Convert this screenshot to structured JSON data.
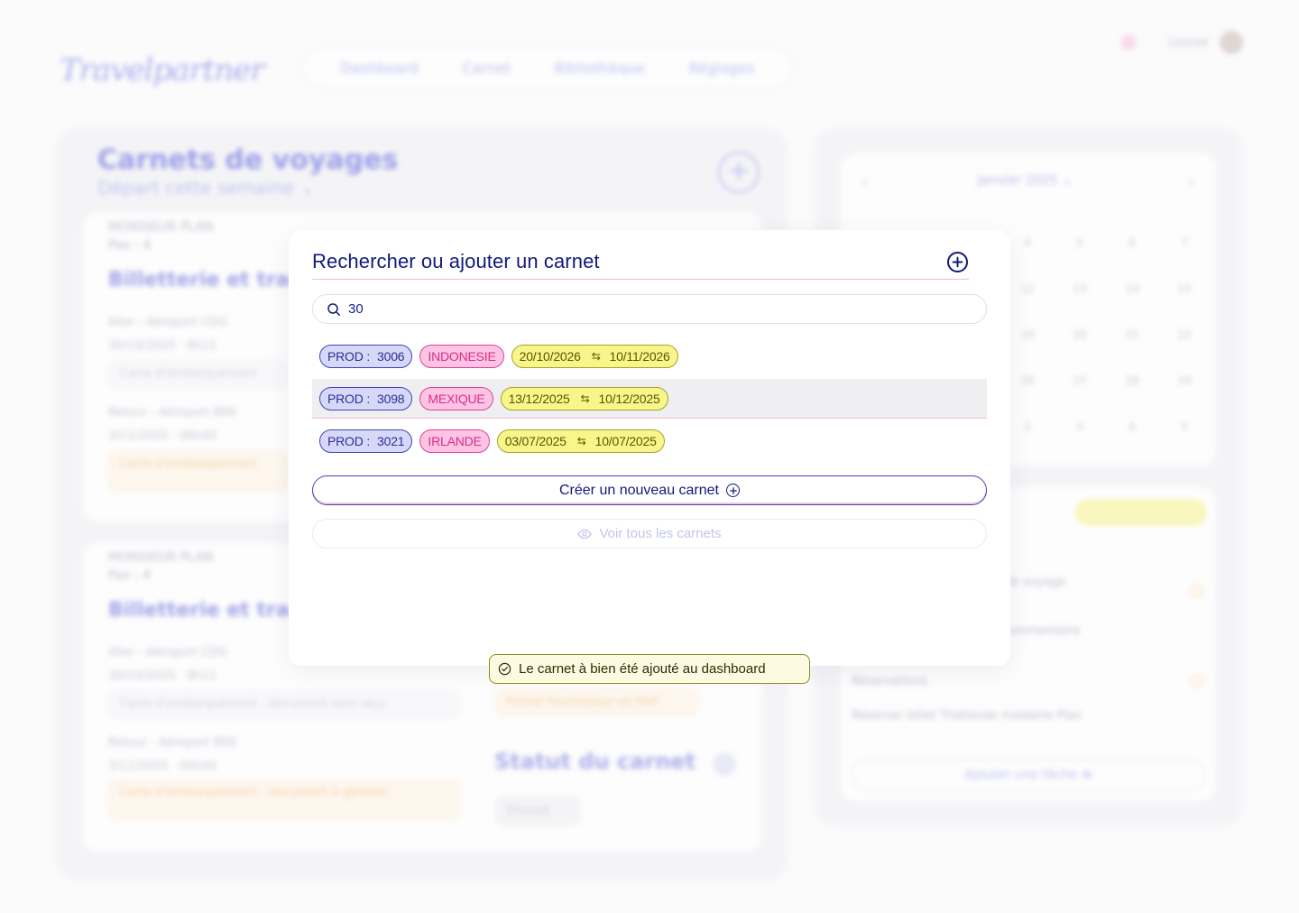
{
  "app": {
    "logo": "Travelpartner",
    "user": "Louise"
  },
  "nav": [
    "Dashboard",
    "Carnet",
    "Bibliothèque",
    "Réglages"
  ],
  "modal": {
    "title": "Rechercher ou ajouter un carnet",
    "search_value": "30",
    "results": [
      {
        "prod_label": "PROD :",
        "prod": "3006",
        "country": "INDONESIE",
        "date_from": "20/10/2026",
        "date_to": "10/11/2026",
        "selected": false
      },
      {
        "prod_label": "PROD :",
        "prod": "3098",
        "country": "MEXIQUE",
        "date_from": "13/12/2025",
        "date_to": "10/12/2025",
        "selected": true
      },
      {
        "prod_label": "PROD :",
        "prod": "3021",
        "country": "IRLANDE",
        "date_from": "03/07/2025",
        "date_to": "10/07/2025",
        "selected": false
      }
    ],
    "create_label": "Créer un nouveau carnet",
    "view_all_label": "Voir tous les carnets"
  },
  "toast": {
    "message": "Le carnet à bien été ajouté au dashboard"
  },
  "colors": {
    "navy": "#12197a",
    "pink": "#d9449a",
    "yellow": "#f8f68a",
    "prod_bg": "#d7d8f8"
  }
}
